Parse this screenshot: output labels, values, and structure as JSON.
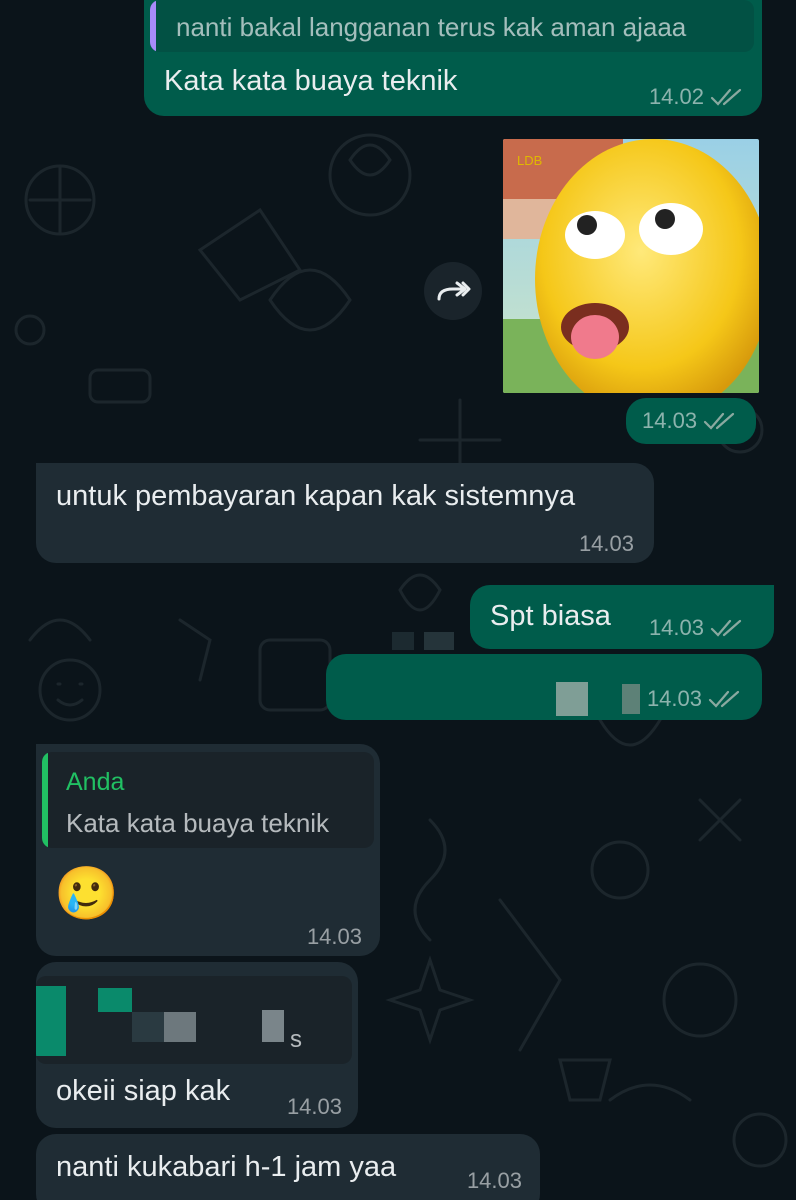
{
  "messages": {
    "m1": {
      "quote_text": "nanti bakal langganan terus kak aman ajaaa",
      "text": "Kata kata buaya teknik",
      "time": "14.02"
    },
    "m2": {
      "time": "14.03",
      "sticker_icon": "yellow-character-sticker",
      "forward_icon": "forward-icon"
    },
    "m3": {
      "text": "untuk pembayaran kapan kak sistemnya",
      "time": "14.03"
    },
    "m4": {
      "text": "Spt biasa",
      "time": "14.03"
    },
    "m5": {
      "time": "14.03"
    },
    "m6": {
      "quote_author": "Anda",
      "quote_text": "Kata kata buaya teknik",
      "emoji": "🥲",
      "time": "14.03"
    },
    "m7": {
      "quote_fragment": "s",
      "text": "okeii siap kak",
      "time": "14.03"
    },
    "m8": {
      "text": "nanti kukabari h-1 jam yaa",
      "time": "14.03"
    }
  },
  "colors": {
    "outgoing_bubble": "#005c4b",
    "incoming_bubble": "#1f2c34",
    "background": "#0b141a",
    "read_ticks": "#8aa9a0",
    "quote_accent": "#21c063"
  }
}
